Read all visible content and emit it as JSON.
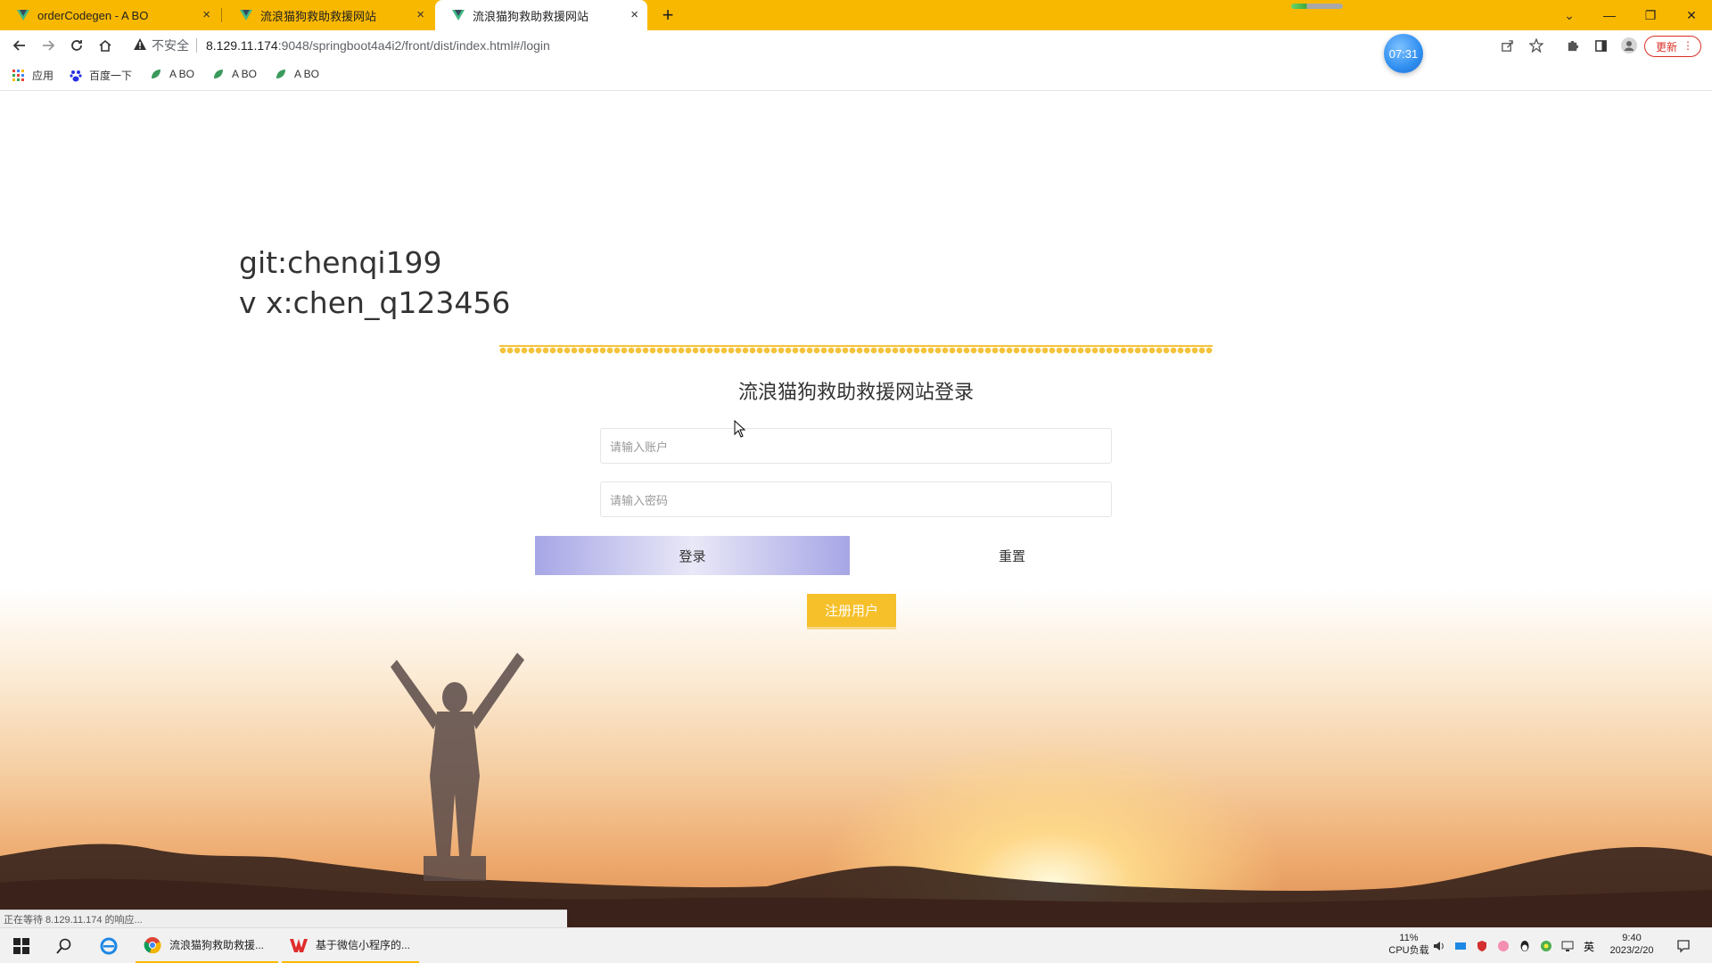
{
  "browser": {
    "tabs": [
      {
        "title": "orderCodegen - A BO",
        "close": "×"
      },
      {
        "title": "流浪猫狗救助救援网站",
        "close": "×"
      },
      {
        "title": "流浪猫狗救助救援网站",
        "close": "×"
      }
    ],
    "new_tab": "+",
    "window_controls": {
      "minimize": "—",
      "restore": "❐",
      "close": "✕",
      "tab_search": "⌄"
    },
    "address": {
      "security_label": "不安全",
      "host": "8.129.11.174",
      "path": ":9048/springboot4a4i2/front/dist/index.html#/login"
    },
    "timer_badge": "07:31",
    "update_label": "更新",
    "update_menu": "⋮",
    "bookmarks": [
      {
        "label": "应用"
      },
      {
        "label": "百度一下"
      },
      {
        "label": "A BO"
      },
      {
        "label": "A BO"
      },
      {
        "label": "A BO"
      }
    ],
    "status_text": "正在等待 8.129.11.174 的响应..."
  },
  "page": {
    "watermark_lines": [
      "git:chenqi199",
      "v x:chen_q123456"
    ],
    "login_title": "流浪猫狗救助救援网站登录",
    "account_placeholder": "请输入账户",
    "password_placeholder": "请输入密码",
    "login_button": "登录",
    "reset_button": "重置",
    "register_button": "注册用户",
    "colors": {
      "accent_yellow": "#f6c02b",
      "login_button_lavender": "#a7a6e6",
      "tab_bar": "#f9b800"
    }
  },
  "taskbar": {
    "apps": [
      {
        "label": "流浪猫狗救助救援..."
      },
      {
        "label": "基于微信小程序的..."
      }
    ],
    "cpu_percent": "11%",
    "cpu_label": "CPU负载",
    "ime": "英",
    "time": "9:40",
    "date": "2023/2/20"
  }
}
